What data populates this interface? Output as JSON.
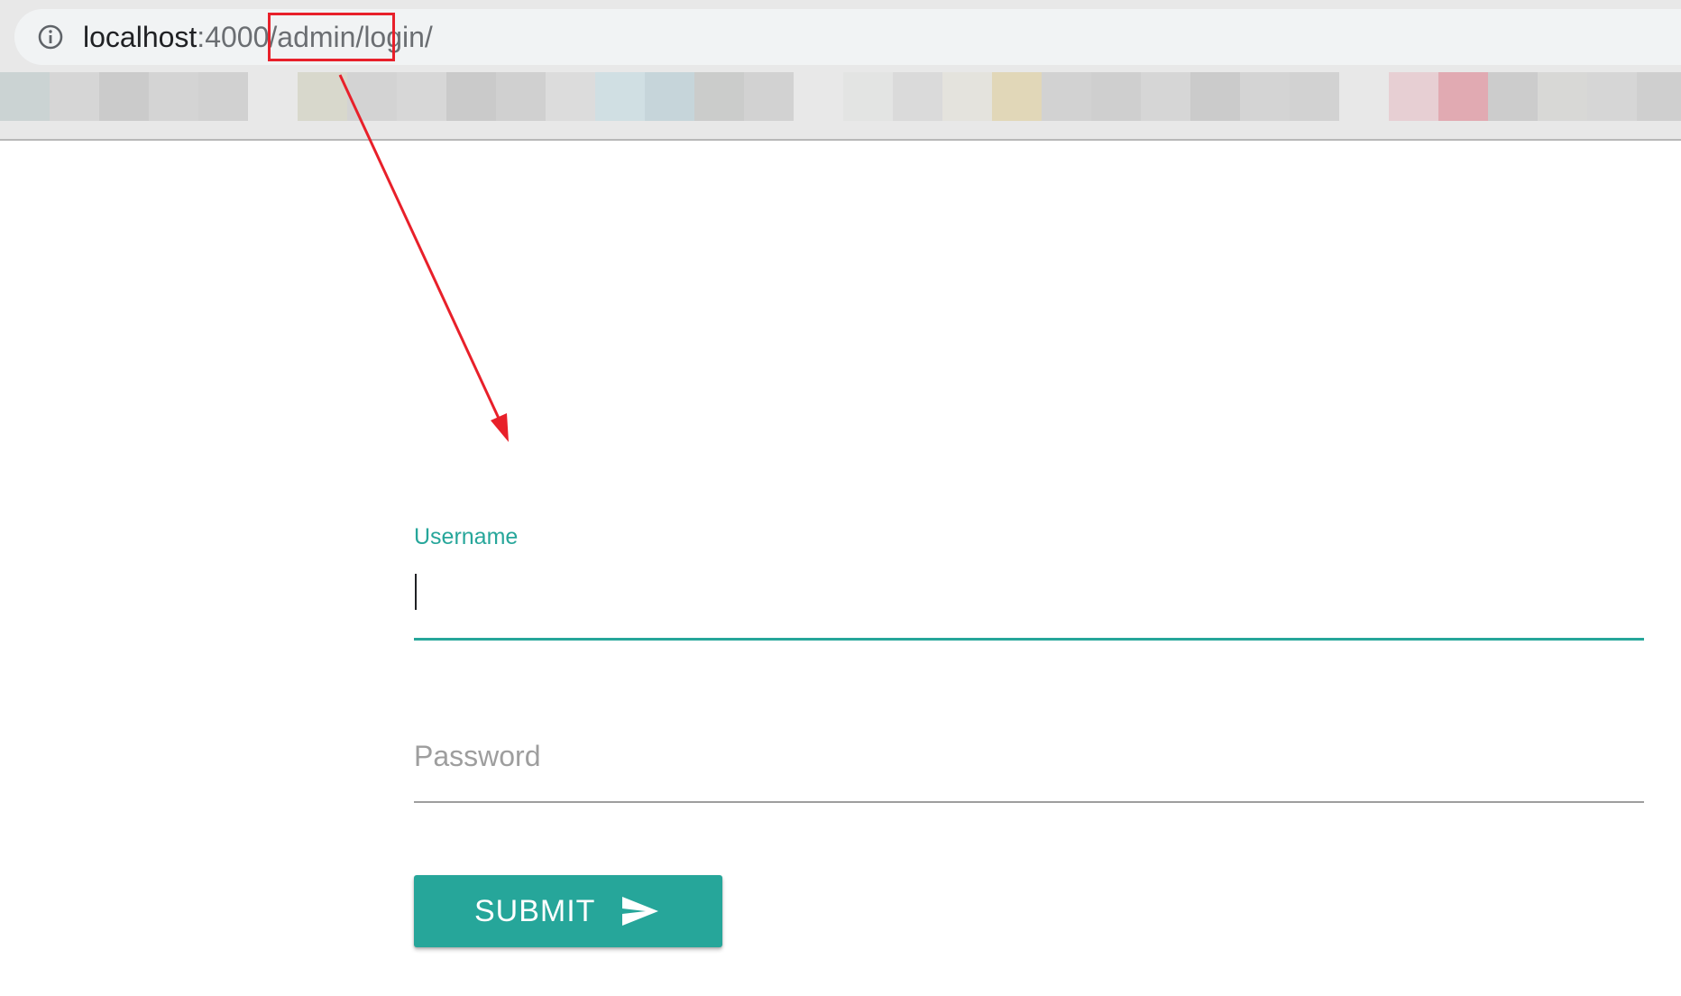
{
  "browser": {
    "address_bar": {
      "info_icon": "info-circle-icon",
      "url_host": "localhost",
      "url_rest": ":4000/admin/login/"
    },
    "bookmarks_bar": {
      "note": "",
      "tile_colors": [
        "#cbd3d3",
        "#d6d6d6",
        "#cbcbcb",
        "#d4d4d4",
        "#d1d1d1",
        "#d8d8cc",
        "#d3d3d3",
        "#d7d7d7",
        "#cacaca",
        "#d0d0d0",
        "#dcdcdc",
        "#d0dfe3",
        "#c6d5da",
        "#cbcccb",
        "#d2d2d2",
        "#e3e4e3",
        "#dadada",
        "#e4e3dd",
        "#e1d7b8",
        "#d2d2d2",
        "#cfcfcf",
        "#d6d6d6",
        "#cbcbcb",
        "#d4d4d4",
        "#d2d2d2",
        "#e7cfd3",
        "#e1aab2",
        "#cccccc",
        "#d8d8d6",
        "#d6d6d6",
        "#cfcfcf"
      ]
    }
  },
  "annotation": {
    "color": "#e8202a"
  },
  "login_form": {
    "username": {
      "label": "Username",
      "value": ""
    },
    "password": {
      "label": "Password",
      "value": ""
    },
    "submit": {
      "label": "SUBMIT",
      "icon": "send-icon"
    },
    "accent_color": "#26a69a"
  }
}
